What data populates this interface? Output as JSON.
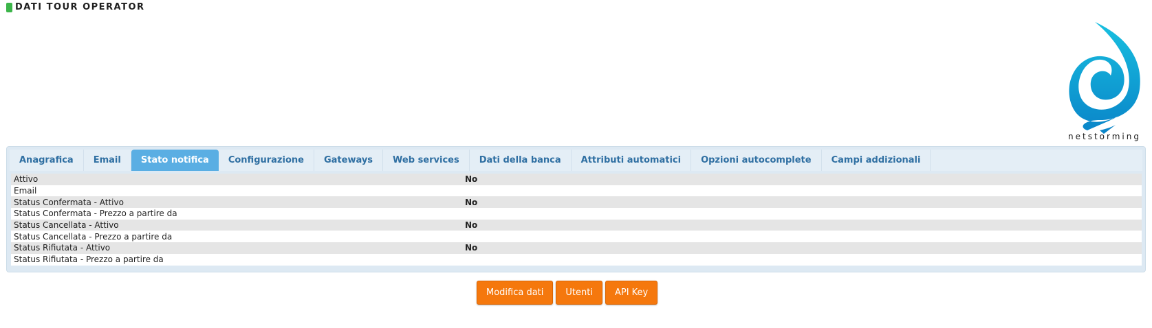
{
  "page": {
    "title": "DATI TOUR OPERATOR"
  },
  "logo": {
    "text": "netstorming"
  },
  "tabs": [
    {
      "label": "Anagrafica",
      "active": false
    },
    {
      "label": "Email",
      "active": false
    },
    {
      "label": "Stato notifica",
      "active": true
    },
    {
      "label": "Configurazione",
      "active": false
    },
    {
      "label": "Gateways",
      "active": false
    },
    {
      "label": "Web services",
      "active": false
    },
    {
      "label": "Dati della banca",
      "active": false
    },
    {
      "label": "Attributi automatici",
      "active": false
    },
    {
      "label": "Opzioni autocomplete",
      "active": false
    },
    {
      "label": "Campi addizionali",
      "active": false
    }
  ],
  "rows": [
    {
      "label": "Attivo",
      "value": "No"
    },
    {
      "label": "Email",
      "value": ""
    },
    {
      "label": "Status Confermata - Attivo",
      "value": "No"
    },
    {
      "label": "Status Confermata - Prezzo a partire da",
      "value": ""
    },
    {
      "label": "Status Cancellata - Attivo",
      "value": "No"
    },
    {
      "label": "Status Cancellata - Prezzo a partire da",
      "value": ""
    },
    {
      "label": "Status Rifiutata - Attivo",
      "value": "No"
    },
    {
      "label": "Status Rifiutata - Prezzo a partire da",
      "value": ""
    }
  ],
  "actions": {
    "edit_label": "Modifica dati",
    "users_label": "Utenti",
    "api_key_label": "API Key"
  },
  "colors": {
    "accent": "#f5780d",
    "tab_active": "#5aaee3",
    "tab_text": "#2f6fa2",
    "title_marker": "#3cb54a"
  }
}
